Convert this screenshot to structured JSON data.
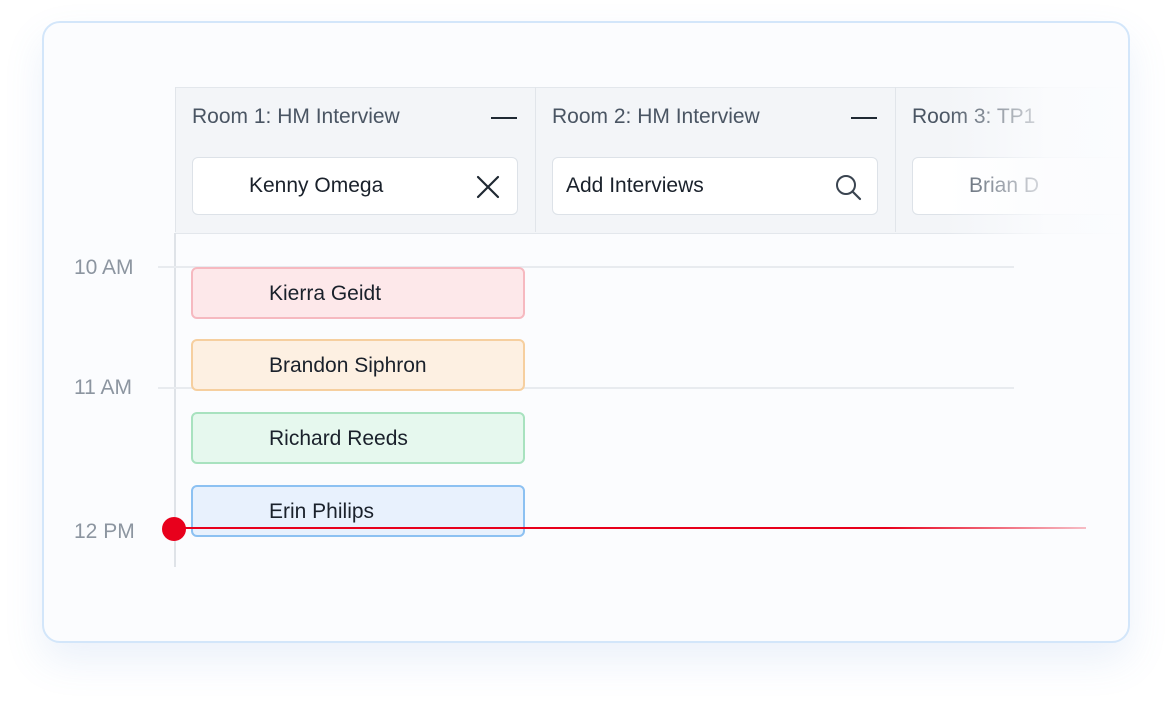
{
  "rooms": [
    {
      "title": "Room 1: HM Interview",
      "picker_value": "Kenny Omega",
      "picker_icon": "close-icon"
    },
    {
      "title": "Room 2: HM Interview",
      "picker_value": "Add Interviews",
      "picker_icon": "search-icon"
    },
    {
      "title": "Room 3: TP1",
      "picker_value": "Brian D",
      "picker_icon": ""
    }
  ],
  "timeline": {
    "hours": [
      "10 AM",
      "11 AM",
      "12 PM"
    ]
  },
  "events": [
    {
      "name": "Kierra Geidt",
      "color": "#fde8ea",
      "border": "#f6b9c0"
    },
    {
      "name": "Brandon Siphron",
      "color": "#fdf0e2",
      "border": "#f6cf9f"
    },
    {
      "name": "Richard Reeds",
      "color": "#e6f8ee",
      "border": "#a8e2bf"
    },
    {
      "name": "Erin Philips",
      "color": "#e8f1fd",
      "border": "#8cc1f2"
    }
  ],
  "colors": {
    "now_indicator": "#e8001c",
    "card_border": "#d3e6fa"
  }
}
